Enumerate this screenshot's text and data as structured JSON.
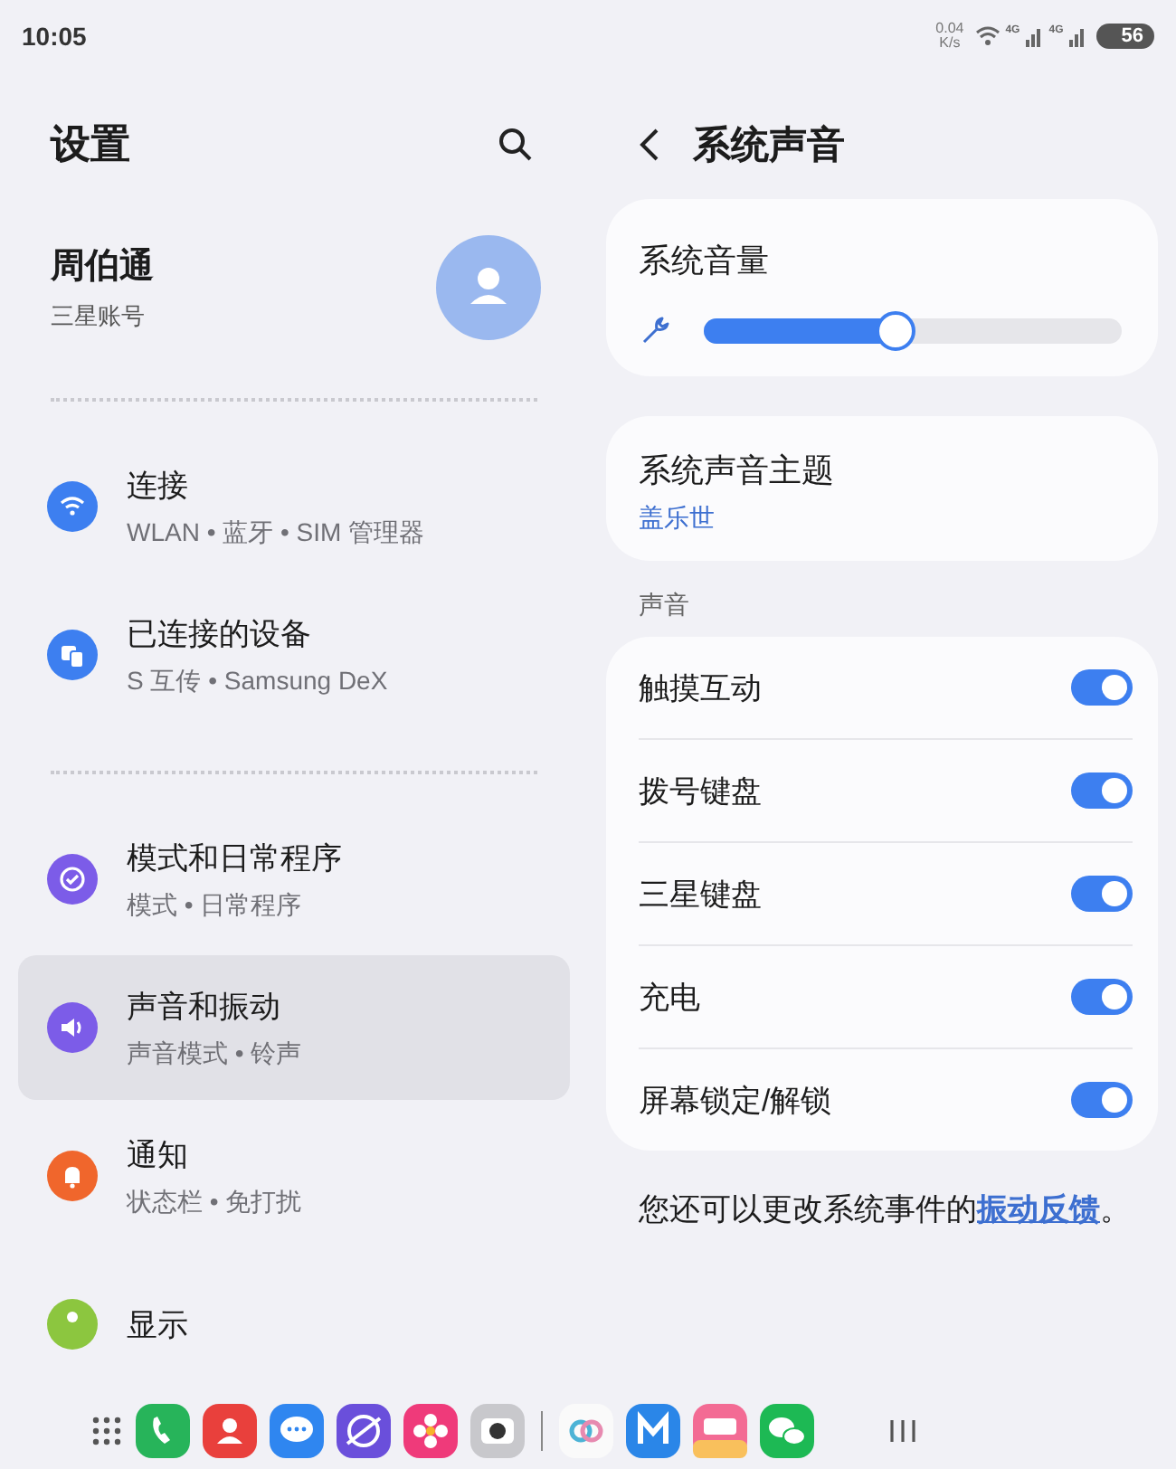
{
  "status_bar": {
    "time": "10:05",
    "net_speed": "0.04",
    "net_unit": "K/s",
    "signal_1": "4G",
    "signal_2": "4G",
    "battery": "56"
  },
  "settings": {
    "title": "设置",
    "profile": {
      "name": "周伯通",
      "account": "三星账号"
    },
    "groups": [
      {
        "items": [
          {
            "kind": "wifi",
            "color": "#3d7ff0",
            "title": "连接",
            "subtitle": "WLAN • 蓝牙 • SIM 管理器",
            "selected": false
          },
          {
            "kind": "devices",
            "color": "#3d7ff0",
            "title": "已连接的设备",
            "subtitle": "S 互传 • Samsung DeX",
            "selected": false
          }
        ]
      },
      {
        "items": [
          {
            "kind": "modes",
            "color": "#7c5ce8",
            "title": "模式和日常程序",
            "subtitle": "模式 • 日常程序",
            "selected": false
          },
          {
            "kind": "sound",
            "color": "#7c5ce8",
            "title": "声音和振动",
            "subtitle": "声音模式 • 铃声",
            "selected": true
          },
          {
            "kind": "bell",
            "color": "#f0662c",
            "title": "通知",
            "subtitle": "状态栏 • 免打扰",
            "selected": false
          },
          {
            "kind": "display",
            "color": "#8cc63f",
            "title": "显示",
            "selected": false
          }
        ]
      }
    ]
  },
  "system_sound": {
    "title": "系统声音",
    "volume": {
      "label": "系统音量",
      "level": 0.46
    },
    "theme": {
      "label": "系统声音主题",
      "value": "盖乐世"
    },
    "section": "声音",
    "rows": [
      {
        "label": "触摸互动",
        "on": true
      },
      {
        "label": "拨号键盘",
        "on": true
      },
      {
        "label": "三星键盘",
        "on": true
      },
      {
        "label": "充电",
        "on": true
      },
      {
        "label": "屏幕锁定/解锁",
        "on": true
      }
    ],
    "footer": "您还可以更改系统事件的",
    "footer_link": "振动反馈",
    "footer_end": "。"
  }
}
